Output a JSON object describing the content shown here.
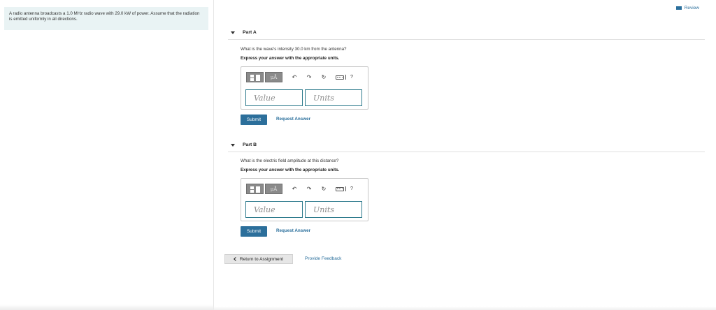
{
  "problem": {
    "statement": "A radio antenna broadcasts a 1.0 MHz radio wave with 29.0 kW of power. Assume that the radiation is emitted uniformly in all directions."
  },
  "header": {
    "review_label": "Review"
  },
  "parts": [
    {
      "title": "Part A",
      "question": "What is the wave's intensity 30.0 km from the antenna?",
      "instruction": "Express your answer with the appropriate units.",
      "toolbar": {
        "units_button": "μÅ",
        "undo": "↶",
        "redo": "↷",
        "reset": "↻",
        "help": "?"
      },
      "value_placeholder": "Value",
      "units_placeholder": "Units",
      "submit_label": "Submit",
      "request_label": "Request Answer"
    },
    {
      "title": "Part B",
      "question": "What is the electric field amplitude at this distance?",
      "instruction": "Express your answer with the appropriate units.",
      "toolbar": {
        "units_button": "μÅ",
        "undo": "↶",
        "redo": "↷",
        "reset": "↻",
        "help": "?"
      },
      "value_placeholder": "Value",
      "units_placeholder": "Units",
      "submit_label": "Submit",
      "request_label": "Request Answer"
    }
  ],
  "footer": {
    "return_label": "Return to Assignment",
    "feedback_label": "Provide Feedback"
  },
  "icons": {
    "template": "template-icon",
    "undo": "undo-icon",
    "redo": "redo-icon",
    "reset": "reset-icon",
    "keyboard": "keyboard-icon",
    "help": "help-icon",
    "review": "review-icon"
  },
  "colors": {
    "accent": "#2c6f9b",
    "link": "#2a6f9c",
    "intro_bg": "#e9f3f4",
    "field_border": "#2d7a8c"
  }
}
